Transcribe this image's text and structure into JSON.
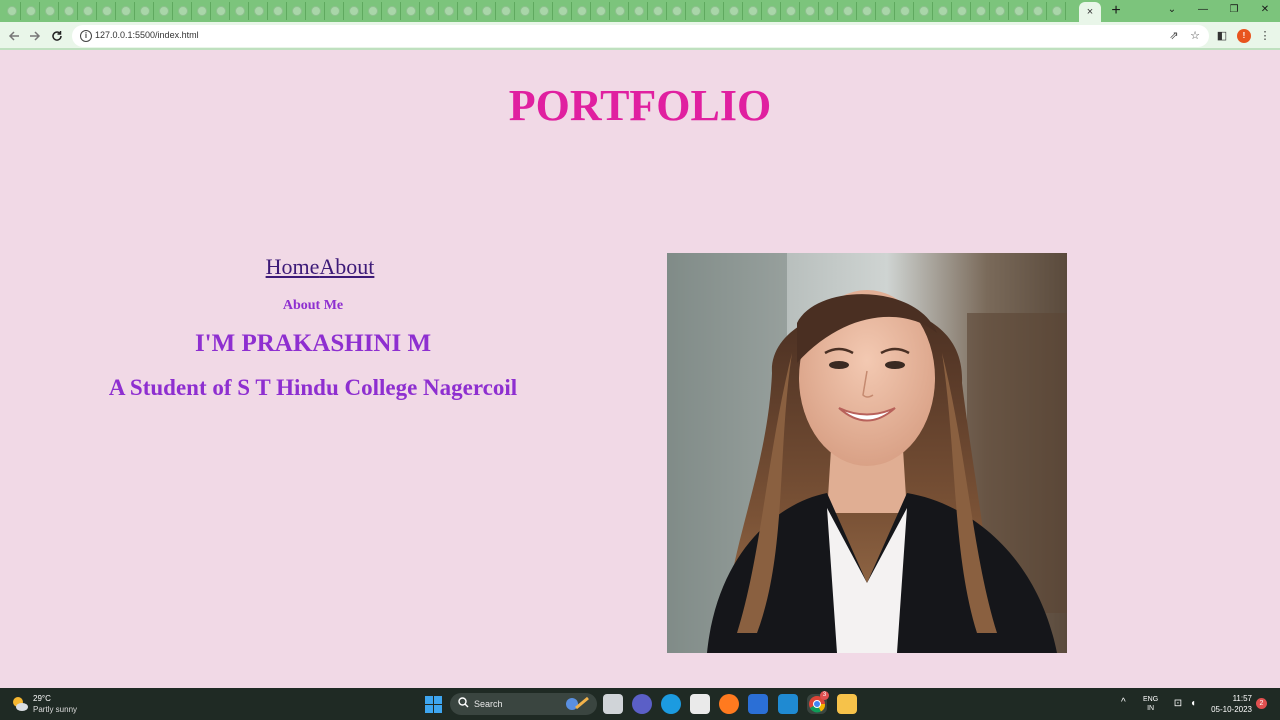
{
  "browser": {
    "url": "127.0.0.1:5500/index.html",
    "tab_close": "×",
    "new_tab": "+",
    "win_controls": {
      "tab_search": "⌄",
      "minimize": "—",
      "maximize": "❐",
      "close": "✕"
    },
    "toolbar_icons": {
      "share": "⇗",
      "bookmark": "☆",
      "side_panel": "◧",
      "menu": "⋮"
    },
    "profile_initial": "!"
  },
  "page": {
    "title": "PORTFOLIO",
    "nav": {
      "home": "Home",
      "about": "About"
    },
    "about_heading": "About Me",
    "intro_name": "I'M PRAKASHINI M",
    "intro_college": "A Student of S T Hindu College Nagercoil"
  },
  "taskbar": {
    "weather_temp": "29°C",
    "weather_desc": "Partly sunny",
    "search_label": "Search",
    "lang_line1": "ENG",
    "lang_line2": "IN",
    "time": "11:57",
    "date": "05-10-2023",
    "notification_count": "2",
    "chrome_badge": "3"
  },
  "colors": {
    "page_bg": "#f1d9e6",
    "title": "#e020a0",
    "text_purple": "#8e2fd0",
    "link": "#3d1a78",
    "tabstrip": "#7cc47c",
    "taskbar": "#1f2a24"
  }
}
